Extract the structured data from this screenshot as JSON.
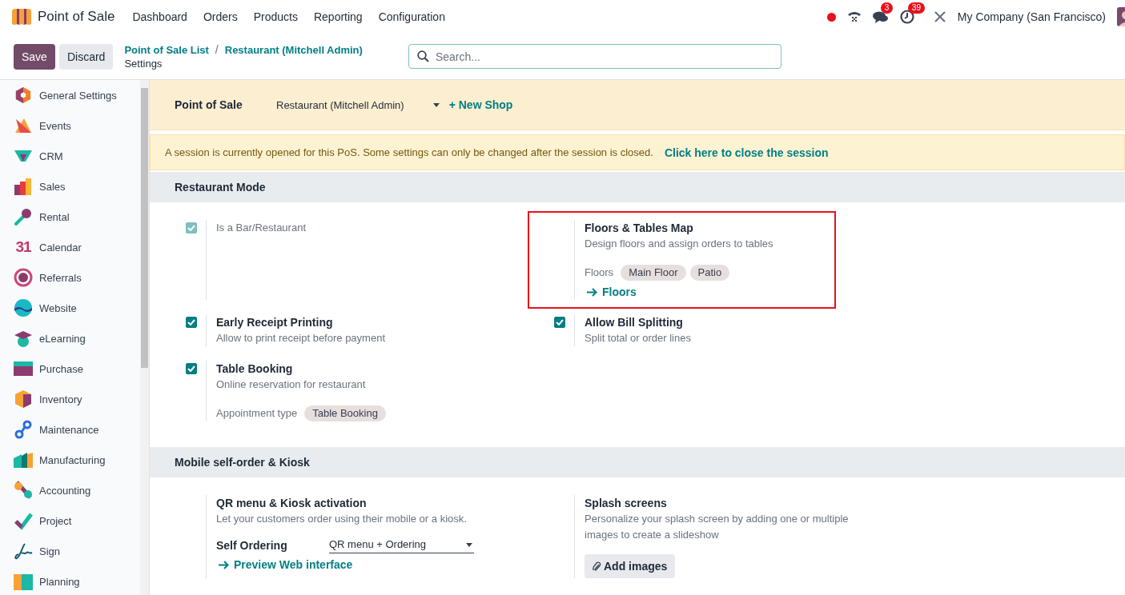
{
  "app": {
    "name": "Point of Sale"
  },
  "menu": [
    "Dashboard",
    "Orders",
    "Products",
    "Reporting",
    "Configuration"
  ],
  "systray": {
    "messages_count": "3",
    "activities_count": "39",
    "company": "My Company (San Francisco)"
  },
  "actions": {
    "save": "Save",
    "discard": "Discard"
  },
  "breadcrumbs": [
    "Point of Sale List",
    "Restaurant (Mitchell Admin)"
  ],
  "breadcrumb_separator": "/",
  "page_title": "Settings",
  "search": {
    "placeholder": "Search..."
  },
  "sidebar": {
    "items": [
      {
        "label": "General Settings"
      },
      {
        "label": "Events"
      },
      {
        "label": "CRM"
      },
      {
        "label": "Sales"
      },
      {
        "label": "Rental"
      },
      {
        "label": "Calendar",
        "icon_text": "31"
      },
      {
        "label": "Referrals"
      },
      {
        "label": "Website"
      },
      {
        "label": "eLearning"
      },
      {
        "label": "Purchase"
      },
      {
        "label": "Inventory"
      },
      {
        "label": "Maintenance"
      },
      {
        "label": "Manufacturing"
      },
      {
        "label": "Accounting"
      },
      {
        "label": "Project"
      },
      {
        "label": "Sign"
      },
      {
        "label": "Planning"
      }
    ]
  },
  "shop_bar": {
    "label": "Point of Sale",
    "value": "Restaurant (Mitchell Admin)",
    "new_shop": "+ New Shop"
  },
  "alert": {
    "text": "A session is currently opened for this PoS. Some settings can only be changed after the session is closed.",
    "link": "Click here to close the session"
  },
  "sections": [
    {
      "title": "Restaurant Mode",
      "settings": [
        {
          "kind": "checkbox",
          "checked": true,
          "disabled": true,
          "title": "Is a Bar/Restaurant"
        },
        {
          "kind": "plain",
          "highlighted": true,
          "title": "Floors & Tables Map",
          "description": "Design floors and assign orders to tables",
          "tags_label": "Floors",
          "tags": [
            "Main Floor",
            "Patio"
          ],
          "link": "Floors"
        },
        {
          "kind": "checkbox",
          "checked": true,
          "disabled": false,
          "title": "Early Receipt Printing",
          "description": "Allow to print receipt before payment"
        },
        {
          "kind": "checkbox",
          "checked": true,
          "disabled": false,
          "title": "Allow Bill Splitting",
          "description": "Split total or order lines"
        },
        {
          "kind": "checkbox",
          "checked": true,
          "disabled": false,
          "title": "Table Booking",
          "description": "Online reservation for restaurant",
          "tags_label": "Appointment type",
          "tags": [
            "Table Booking"
          ]
        }
      ]
    },
    {
      "title": "Mobile self-order & Kiosk",
      "settings": [
        {
          "kind": "plain",
          "title": "QR menu & Kiosk activation",
          "description": "Let your customers order using their mobile or a kiosk.",
          "field": {
            "label": "Self Ordering",
            "value": "QR menu + Ordering"
          },
          "link": "Preview Web interface"
        },
        {
          "kind": "plain",
          "title": "Splash screens",
          "description": "Personalize your splash screen by adding one or multiple images to create a slideshow",
          "button": "Add images"
        }
      ]
    }
  ]
}
